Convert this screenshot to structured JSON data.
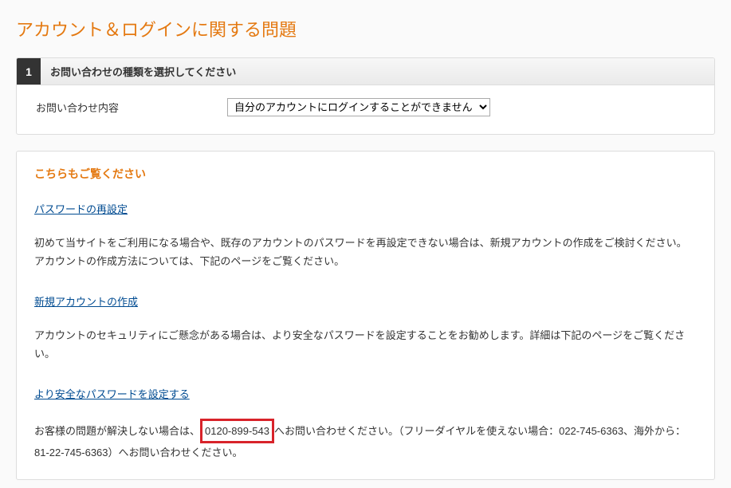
{
  "page_title": "アカウント＆ログインに関する問題",
  "step": {
    "number": "1",
    "title": "お問い合わせの種類を選択してください"
  },
  "form": {
    "label": "お問い合わせ内容",
    "selected": "自分のアカウントにログインすることができません"
  },
  "info": {
    "title": "こちらもご覧ください",
    "link1": "パスワードの再設定",
    "para1": "初めて当サイトをご利用になる場合や、既存のアカウントのパスワードを再設定できない場合は、新規アカウントの作成をご検討ください。アカウントの作成方法については、下記のページをご覧ください。",
    "link2": "新規アカウントの作成",
    "para2": "アカウントのセキュリティにご懸念がある場合は、より安全なパスワードを設定することをお勧めします。詳細は下記のページをご覧ください。",
    "link3": "より安全なパスワードを設定する",
    "contact_prefix": "お客様の問題が解決しない場合は、",
    "contact_phone": "0120-899-543",
    "contact_suffix": "へお問い合わせください。（フリーダイヤルを使えない場合：022-745-6363、海外から：81-22-745-6363）へお問い合わせください。"
  }
}
